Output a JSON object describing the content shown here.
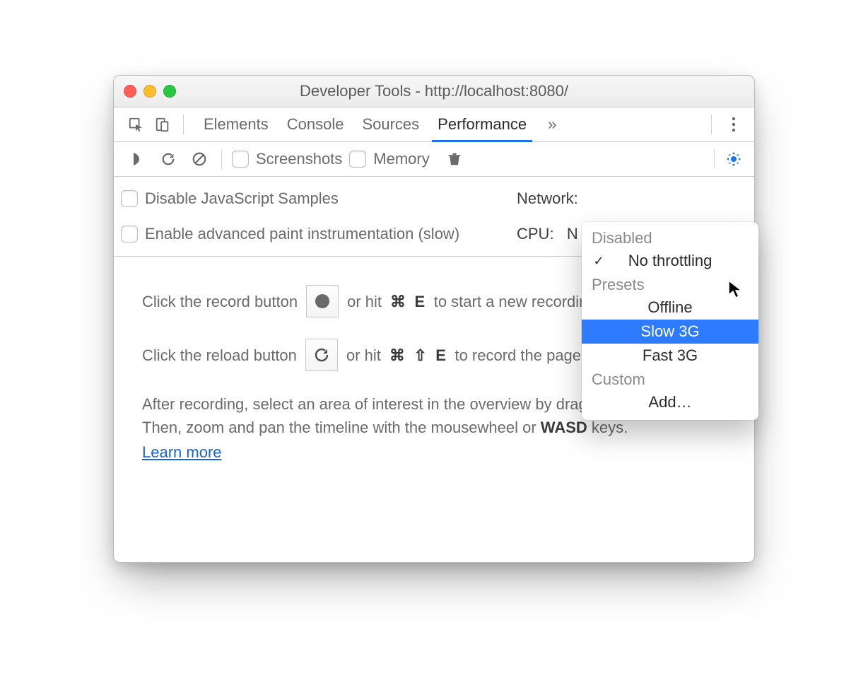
{
  "window": {
    "title": "Developer Tools - http://localhost:8080/"
  },
  "tabs": {
    "elements": "Elements",
    "console": "Console",
    "sources": "Sources",
    "performance": "Performance",
    "more": "»"
  },
  "toolbar": {
    "screenshots": "Screenshots",
    "memory": "Memory"
  },
  "settings": {
    "disable_js_samples": "Disable JavaScript Samples",
    "enable_paint": "Enable advanced paint instrumentation (slow)",
    "network_label": "Network:",
    "cpu_label": "CPU:",
    "cpu_value": "N"
  },
  "popup": {
    "section_disabled": "Disabled",
    "no_throttling": "No throttling",
    "section_presets": "Presets",
    "offline": "Offline",
    "slow3g": "Slow 3G",
    "fast3g": "Fast 3G",
    "section_custom": "Custom",
    "add": "Add…"
  },
  "main": {
    "record_pre": "Click the record button",
    "record_post": "or hit",
    "record_key1": "⌘",
    "record_key2": "E",
    "record_end": "to start a new recording.",
    "reload_pre": "Click the reload button",
    "reload_post": "or hit",
    "reload_key1": "⌘",
    "reload_key2": "⇧",
    "reload_key3": "E",
    "reload_end": "to record the page load.",
    "after1": "After recording, select an area of interest in the overview by dragging.",
    "after2_pre": "Then, zoom and pan the timeline with the mousewheel or ",
    "after2_bold": "WASD",
    "after2_post": " keys.",
    "learn_more": "Learn more"
  }
}
